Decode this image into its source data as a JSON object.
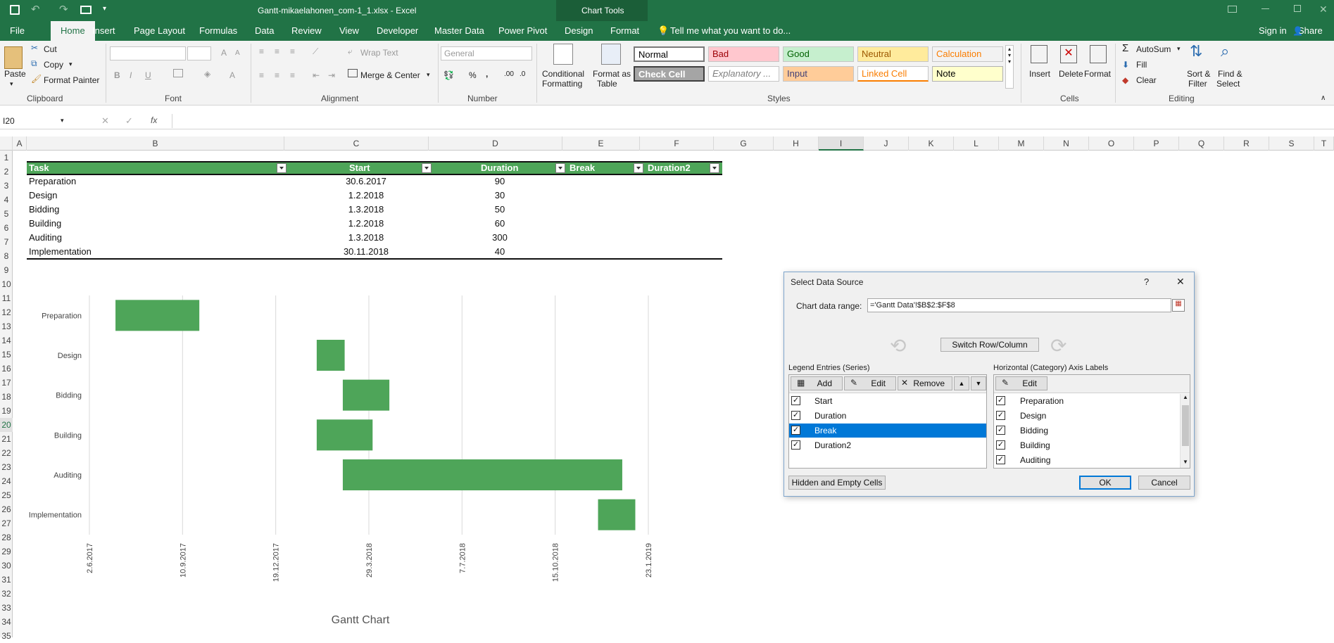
{
  "window": {
    "title": "Gantt-mikaelahonen_com-1_1.xlsx - Excel",
    "context_title": "Chart Tools",
    "sign_in": "Sign in",
    "share": "Share"
  },
  "tabs": [
    "File",
    "Home",
    "Insert",
    "Page Layout",
    "Formulas",
    "Data",
    "Review",
    "View",
    "Developer",
    "Master Data",
    "Power Pivot",
    "Design",
    "Format"
  ],
  "tell_me": "Tell me what you want to do...",
  "ribbon": {
    "clipboard": {
      "paste": "Paste",
      "cut": "Cut",
      "copy": "Copy",
      "format_painter": "Format Painter",
      "label": "Clipboard"
    },
    "font": {
      "label": "Font",
      "bold": "B",
      "italic": "I",
      "underline": "U"
    },
    "alignment": {
      "wrap_text": "Wrap Text",
      "merge_center": "Merge & Center",
      "label": "Alignment"
    },
    "number": {
      "format": "General",
      "label": "Number",
      "percent": "%",
      "comma": ","
    },
    "styles": {
      "conditional": "Conditional",
      "formatting": "Formatting",
      "format_as": "Format as",
      "table": "Table",
      "label": "Styles",
      "cells": [
        {
          "name": "Normal",
          "bg": "#ffffff",
          "fg": "#000000"
        },
        {
          "name": "Bad",
          "bg": "#ffc7ce",
          "fg": "#9c0006"
        },
        {
          "name": "Good",
          "bg": "#c6efce",
          "fg": "#006100"
        },
        {
          "name": "Neutral",
          "bg": "#ffeb9c",
          "fg": "#9c5700"
        },
        {
          "name": "Calculation",
          "bg": "#f2f2f2",
          "fg": "#fa7d00"
        },
        {
          "name": "Check Cell",
          "bg": "#a5a5a5",
          "fg": "#ffffff"
        },
        {
          "name": "Explanatory ...",
          "bg": "#ffffff",
          "fg": "#7f7f7f"
        },
        {
          "name": "Input",
          "bg": "#ffcc99",
          "fg": "#3f3f76"
        },
        {
          "name": "Linked Cell",
          "bg": "#ffffff",
          "fg": "#fa7d00"
        },
        {
          "name": "Note",
          "bg": "#ffffcc",
          "fg": "#000000"
        }
      ]
    },
    "cells": {
      "insert": "Insert",
      "delete": "Delete",
      "format": "Format",
      "label": "Cells"
    },
    "editing": {
      "autosum": "AutoSum",
      "fill": "Fill",
      "clear": "Clear",
      "sort_filter": "Sort &",
      "filter": "Filter",
      "find_select": "Find &",
      "select": "Select",
      "label": "Editing"
    }
  },
  "formula_bar": {
    "name_box": "I20",
    "fx": "fx",
    "content": ""
  },
  "columns": [
    "A",
    "B",
    "C",
    "D",
    "E",
    "F",
    "G",
    "H",
    "I",
    "J",
    "K",
    "L",
    "M",
    "N",
    "O",
    "P",
    "Q",
    "R",
    "S",
    "T"
  ],
  "rows": [
    "1",
    "2",
    "3",
    "4",
    "5",
    "6",
    "7",
    "8",
    "9",
    "10",
    "11",
    "12",
    "13",
    "14",
    "15",
    "16",
    "17",
    "18",
    "19",
    "20",
    "21",
    "22",
    "23",
    "24",
    "25",
    "26",
    "27",
    "28",
    "29",
    "30",
    "31",
    "32",
    "33",
    "34",
    "35"
  ],
  "table": {
    "headers": [
      "Task",
      "Start",
      "Duration",
      "Break",
      "Duration2"
    ],
    "rows": [
      [
        "Preparation",
        "30.6.2017",
        "90",
        "",
        ""
      ],
      [
        "Design",
        "1.2.2018",
        "30",
        "",
        ""
      ],
      [
        "Bidding",
        "1.3.2018",
        "50",
        "",
        ""
      ],
      [
        "Building",
        "1.2.2018",
        "60",
        "",
        ""
      ],
      [
        "Auditing",
        "1.3.2018",
        "300",
        "",
        ""
      ],
      [
        "Implementation",
        "30.11.2018",
        "40",
        "",
        ""
      ]
    ]
  },
  "chart_data": {
    "type": "bar",
    "orientation": "horizontal",
    "title": "Gantt Chart",
    "categories": [
      "Preparation",
      "Design",
      "Bidding",
      "Building",
      "Auditing",
      "Implementation"
    ],
    "series": [
      {
        "name": "Start",
        "values": [
          "30.6.2017",
          "1.2.2018",
          "1.3.2018",
          "1.2.2018",
          "1.3.2018",
          "30.11.2018"
        ],
        "visible": false
      },
      {
        "name": "Duration",
        "values": [
          90,
          30,
          50,
          60,
          300,
          40
        ],
        "color": "#4ea559"
      }
    ],
    "x_ticks": [
      "2.6.2017",
      "10.9.2017",
      "19.12.2017",
      "29.3.2018",
      "7.7.2018",
      "15.10.2018",
      "23.1.2019"
    ],
    "xlim": [
      "2.6.2017",
      "23.1.2019"
    ],
    "grid": true
  },
  "dialog": {
    "title": "Select Data Source",
    "help": "?",
    "close": "✕",
    "range_label": "Chart data range:",
    "range_value": "='Gantt Data'!$B$2:$F$8",
    "switch": "Switch Row/Column",
    "legend_label": "Legend Entries (Series)",
    "axis_label": "Horizontal (Category) Axis Labels",
    "add": "Add",
    "edit": "Edit",
    "remove": "Remove",
    "axis_edit": "Edit",
    "series": [
      "Start",
      "Duration",
      "Break",
      "Duration2"
    ],
    "selected_series": "Break",
    "axis_items": [
      "Preparation",
      "Design",
      "Bidding",
      "Building",
      "Auditing"
    ],
    "hidden_cells": "Hidden and Empty Cells",
    "ok": "OK",
    "cancel": "Cancel"
  }
}
